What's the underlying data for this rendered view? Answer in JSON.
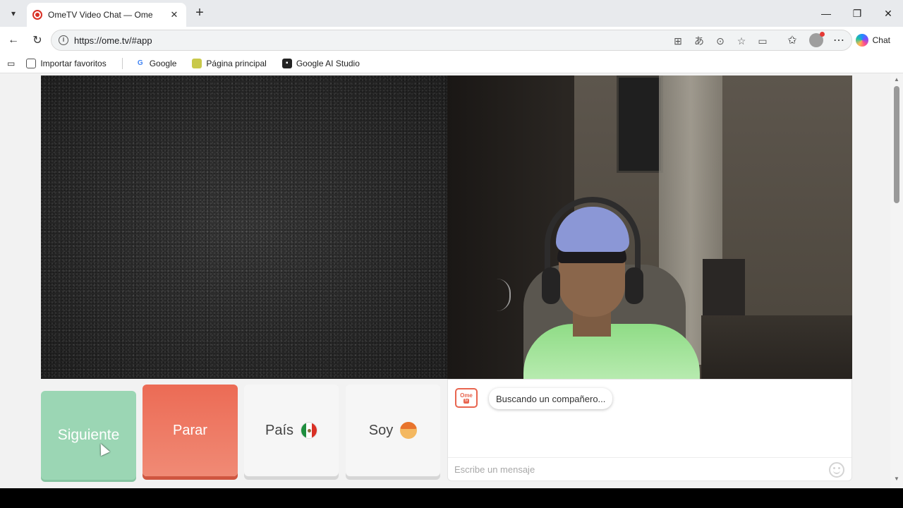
{
  "browser": {
    "tab": {
      "title": "OmeTV Video Chat — Omegl"
    },
    "url": "https://ome.tv/#app",
    "chat_label": "Chat",
    "window_controls": {
      "minimize": "—",
      "maximize": "❐",
      "close": "✕"
    },
    "bookmarks": [
      {
        "label": "Importar favoritos",
        "icon": "import-icon"
      },
      {
        "label": "Google",
        "icon": "google-icon"
      },
      {
        "label": "Página principal",
        "icon": "home-icon"
      },
      {
        "label": "Google AI Studio",
        "icon": "ai-studio-icon"
      }
    ]
  },
  "app": {
    "controls": {
      "next_label": "Siguiente",
      "stop_label": "Parar",
      "country_label": "País",
      "country_flag": "mexico-flag-icon",
      "gender_label": "Soy",
      "gender_icon": "boy-emoji-icon"
    },
    "chat": {
      "status_message": "Buscando un compañero...",
      "logo_text": "Ome",
      "logo_sub": "tv",
      "input_placeholder": "Escribe un mensaje"
    },
    "colors": {
      "next_button": "#9bd6b4",
      "stop_button": "#ec6b55",
      "accent": "#e8654f"
    }
  }
}
